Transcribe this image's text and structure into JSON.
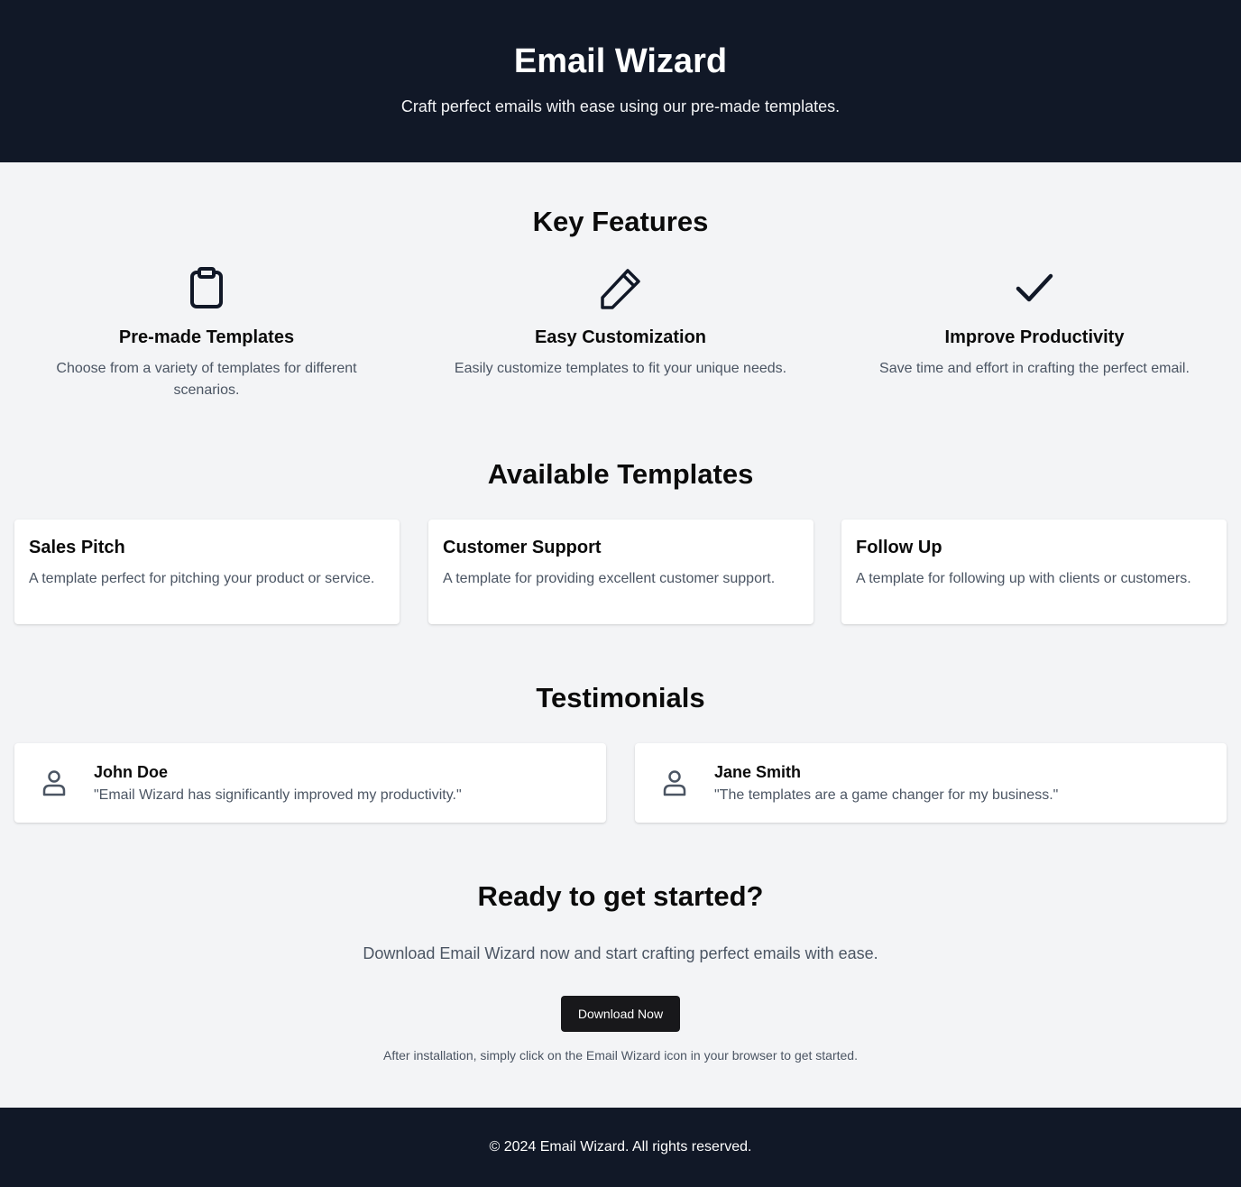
{
  "header": {
    "title": "Email Wizard",
    "subtitle": "Craft perfect emails with ease using our pre-made templates."
  },
  "features": {
    "title": "Key Features",
    "items": [
      {
        "icon": "clipboard-icon",
        "title": "Pre-made Templates",
        "description": "Choose from a variety of templates for different scenarios."
      },
      {
        "icon": "pencil-icon",
        "title": "Easy Customization",
        "description": "Easily customize templates to fit your unique needs."
      },
      {
        "icon": "check-icon",
        "title": "Improve Productivity",
        "description": "Save time and effort in crafting the perfect email."
      }
    ]
  },
  "templates": {
    "title": "Available Templates",
    "items": [
      {
        "title": "Sales Pitch",
        "description": "A template perfect for pitching your product or service."
      },
      {
        "title": "Customer Support",
        "description": "A template for providing excellent customer support."
      },
      {
        "title": "Follow Up",
        "description": "A template for following up with clients or customers."
      }
    ]
  },
  "testimonials": {
    "title": "Testimonials",
    "items": [
      {
        "icon": "user-icon",
        "name": "John Doe",
        "quote": "\"Email Wizard has significantly improved my productivity.\""
      },
      {
        "icon": "user-icon",
        "name": "Jane Smith",
        "quote": "\"The templates are a game changer for my business.\""
      }
    ]
  },
  "cta": {
    "title": "Ready to get started?",
    "subtitle": "Download Email Wizard now and start crafting perfect emails with ease.",
    "button_label": "Download Now",
    "note": "After installation, simply click on the Email Wizard icon in your browser to get started."
  },
  "footer": {
    "text": "© 2024 Email Wizard. All rights reserved."
  },
  "colors": {
    "header_bg": "#111827",
    "page_bg": "#f3f4f6",
    "button_bg": "#18181b",
    "muted_text": "#4b5563"
  }
}
